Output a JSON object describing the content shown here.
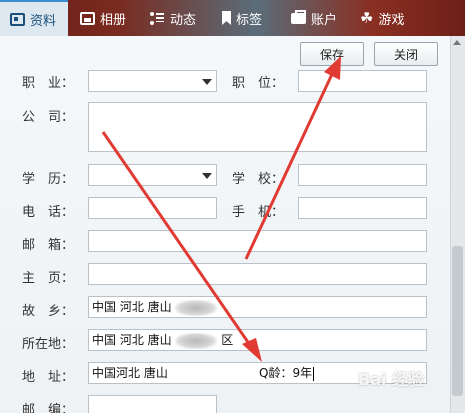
{
  "tabs": [
    {
      "label": "资料",
      "icon": "profile-card-icon",
      "active": true
    },
    {
      "label": "相册",
      "icon": "photo-album-icon",
      "active": false
    },
    {
      "label": "动态",
      "icon": "feed-list-icon",
      "active": false
    },
    {
      "label": "标签",
      "icon": "bookmark-icon",
      "active": false
    },
    {
      "label": "账户",
      "icon": "wallet-icon",
      "active": false
    },
    {
      "label": "游戏",
      "icon": "game-controller-icon",
      "active": false
    }
  ],
  "toolbar": {
    "save_label": "保存",
    "close_label": "关闭"
  },
  "form": {
    "occupation_label": "职　业：",
    "occupation_value": "",
    "position_label": "职　位：",
    "position_value": "",
    "company_label": "公　司：",
    "company_value": "",
    "education_label": "学　历：",
    "education_value": "",
    "school_label": "学　校：",
    "school_value": "",
    "phone_label": "电　话：",
    "phone_value": "",
    "mobile_label": "手　机：",
    "mobile_value": "",
    "email_label": "邮　箱：",
    "email_value": "",
    "homepage_label": "主　页：",
    "homepage_value": "",
    "hometown_label": "故　乡：",
    "hometown_value": "中国 河北 唐山",
    "location_label": "所在地：",
    "location_value": "中国 河北 唐山",
    "location_suffix": "区",
    "address_label": "地　址：",
    "address_value": "中国河北 唐山",
    "address_age_text": "Q龄：9年",
    "postcode_label": "邮　编：",
    "postcode_value": ""
  },
  "watermark": "Bai 经验",
  "colors": {
    "annotation_arrow": "#e03a33",
    "active_tab_bg": "#dde8f0"
  }
}
